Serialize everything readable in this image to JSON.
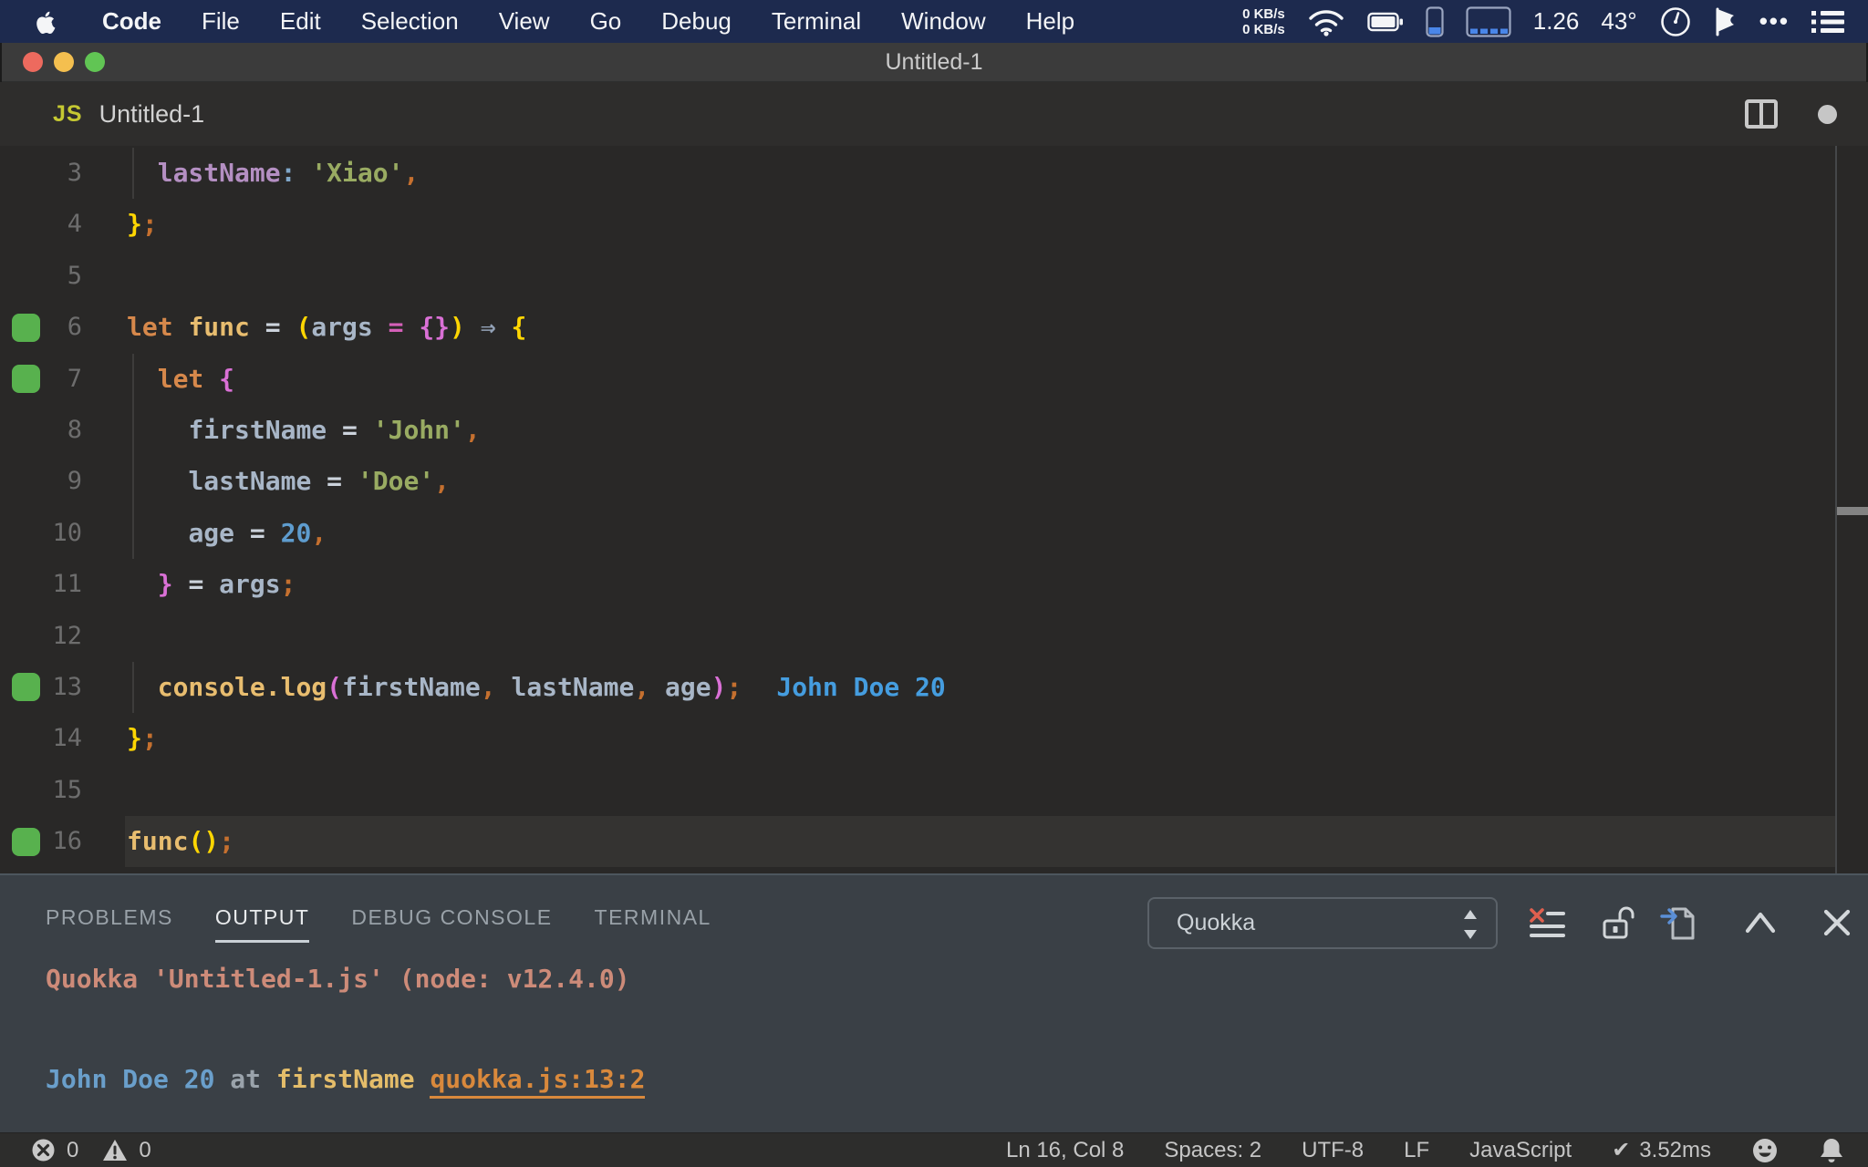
{
  "menubar": {
    "items": [
      {
        "label": "Code",
        "bold": true
      },
      {
        "label": "File"
      },
      {
        "label": "Edit"
      },
      {
        "label": "Selection"
      },
      {
        "label": "View"
      },
      {
        "label": "Go"
      },
      {
        "label": "Debug"
      },
      {
        "label": "Terminal"
      },
      {
        "label": "Window"
      },
      {
        "label": "Help"
      }
    ],
    "status": {
      "net_up": "0 KB/s",
      "net_down": "0 KB/s",
      "load": "1.26",
      "temp": "43°",
      "dots": "•••"
    }
  },
  "window": {
    "title": "Untitled-1"
  },
  "tab": {
    "file_icon": "JS",
    "label": "Untitled-1"
  },
  "editor": {
    "lines": [
      {
        "num": "3",
        "guide": true,
        "tokens": [
          {
            "t": "  ",
            "c": ""
          },
          {
            "t": "lastName",
            "c": "prop"
          },
          {
            "t": ":",
            "c": "colon"
          },
          {
            "t": " ",
            "c": ""
          },
          {
            "t": "'Xiao'",
            "c": "str"
          },
          {
            "t": ",",
            "c": "pun"
          }
        ]
      },
      {
        "num": "4",
        "tokens": [
          {
            "t": "}",
            "c": "b1"
          },
          {
            "t": ";",
            "c": "pun"
          }
        ]
      },
      {
        "num": "5",
        "tokens": []
      },
      {
        "num": "6",
        "marker": true,
        "tokens": [
          {
            "t": "let",
            "c": "kw"
          },
          {
            "t": " ",
            "c": ""
          },
          {
            "t": "func",
            "c": "fn"
          },
          {
            "t": " ",
            "c": ""
          },
          {
            "t": "=",
            "c": "op"
          },
          {
            "t": " ",
            "c": ""
          },
          {
            "t": "(",
            "c": "b1"
          },
          {
            "t": "args",
            "c": "var"
          },
          {
            "t": " ",
            "c": ""
          },
          {
            "t": "=",
            "c": "pink"
          },
          {
            "t": " ",
            "c": ""
          },
          {
            "t": "{}",
            "c": "b2"
          },
          {
            "t": ")",
            "c": "b1"
          },
          {
            "t": " ",
            "c": ""
          },
          {
            "t": "⇒",
            "c": "arrow"
          },
          {
            "t": " ",
            "c": ""
          },
          {
            "t": "{",
            "c": "b1"
          }
        ]
      },
      {
        "num": "7",
        "marker": true,
        "guide": true,
        "tokens": [
          {
            "t": "  ",
            "c": ""
          },
          {
            "t": "let",
            "c": "kw"
          },
          {
            "t": " ",
            "c": ""
          },
          {
            "t": "{",
            "c": "b2"
          }
        ]
      },
      {
        "num": "8",
        "guide": true,
        "tokens": [
          {
            "t": "    ",
            "c": ""
          },
          {
            "t": "firstName",
            "c": "var"
          },
          {
            "t": " ",
            "c": ""
          },
          {
            "t": "=",
            "c": "op"
          },
          {
            "t": " ",
            "c": ""
          },
          {
            "t": "'John'",
            "c": "str"
          },
          {
            "t": ",",
            "c": "pun"
          }
        ]
      },
      {
        "num": "9",
        "guide": true,
        "tokens": [
          {
            "t": "    ",
            "c": ""
          },
          {
            "t": "lastName",
            "c": "var"
          },
          {
            "t": " ",
            "c": ""
          },
          {
            "t": "=",
            "c": "op"
          },
          {
            "t": " ",
            "c": ""
          },
          {
            "t": "'Doe'",
            "c": "str"
          },
          {
            "t": ",",
            "c": "pun"
          }
        ]
      },
      {
        "num": "10",
        "guide": true,
        "tokens": [
          {
            "t": "    ",
            "c": ""
          },
          {
            "t": "age",
            "c": "var"
          },
          {
            "t": " ",
            "c": ""
          },
          {
            "t": "=",
            "c": "op"
          },
          {
            "t": " ",
            "c": ""
          },
          {
            "t": "20",
            "c": "num"
          },
          {
            "t": ",",
            "c": "pun"
          }
        ]
      },
      {
        "num": "11",
        "tokens": [
          {
            "t": "  ",
            "c": ""
          },
          {
            "t": "}",
            "c": "b2"
          },
          {
            "t": " ",
            "c": ""
          },
          {
            "t": "=",
            "c": "op"
          },
          {
            "t": " ",
            "c": ""
          },
          {
            "t": "args",
            "c": "var"
          },
          {
            "t": ";",
            "c": "pun"
          }
        ]
      },
      {
        "num": "12",
        "tokens": []
      },
      {
        "num": "13",
        "marker": true,
        "guide": true,
        "inline": "John Doe 20",
        "tokens": [
          {
            "t": "  ",
            "c": ""
          },
          {
            "t": "console",
            "c": "fn"
          },
          {
            "t": ".",
            "c": "fn"
          },
          {
            "t": "log",
            "c": "fn"
          },
          {
            "t": "(",
            "c": "b2"
          },
          {
            "t": "firstName",
            "c": "var"
          },
          {
            "t": ",",
            "c": "pun"
          },
          {
            "t": " ",
            "c": ""
          },
          {
            "t": "lastName",
            "c": "var"
          },
          {
            "t": ",",
            "c": "pun"
          },
          {
            "t": " ",
            "c": ""
          },
          {
            "t": "age",
            "c": "var"
          },
          {
            "t": ")",
            "c": "b2"
          },
          {
            "t": ";",
            "c": "pun"
          }
        ]
      },
      {
        "num": "14",
        "tokens": [
          {
            "t": "}",
            "c": "b1"
          },
          {
            "t": ";",
            "c": "pun"
          }
        ]
      },
      {
        "num": "15",
        "tokens": []
      },
      {
        "num": "16",
        "marker": true,
        "current": true,
        "tokens": [
          {
            "t": "func",
            "c": "fn"
          },
          {
            "t": "(",
            "c": "b1"
          },
          {
            "t": ")",
            "c": "b1"
          },
          {
            "t": ";",
            "c": "pun"
          }
        ]
      }
    ]
  },
  "panel": {
    "tabs": [
      {
        "label": "PROBLEMS",
        "active": false
      },
      {
        "label": "OUTPUT",
        "active": true
      },
      {
        "label": "DEBUG CONSOLE",
        "active": false
      },
      {
        "label": "TERMINAL",
        "active": false
      }
    ],
    "channel": "Quokka",
    "output": [
      {
        "tokens": [
          {
            "t": "Quokka 'Untitled-1.js' (node: v12.4.0)",
            "c": "out-salmon"
          }
        ]
      },
      {
        "tokens": []
      },
      {
        "tokens": [
          {
            "t": "John Doe 20",
            "c": "out-blue"
          },
          {
            "t": " at ",
            "c": "out-gray"
          },
          {
            "t": "firstName",
            "c": "out-yellow"
          },
          {
            "t": " ",
            "c": "out-gray"
          },
          {
            "t": "quokka.js:13:2",
            "c": "out-link",
            "link": true
          }
        ]
      }
    ]
  },
  "statusbar": {
    "errors": "0",
    "warnings": "0",
    "items": [
      "Ln 16, Col 8",
      "Spaces: 2",
      "UTF-8",
      "LF",
      "JavaScript"
    ],
    "check": "✔",
    "perf": "3.52ms"
  }
}
